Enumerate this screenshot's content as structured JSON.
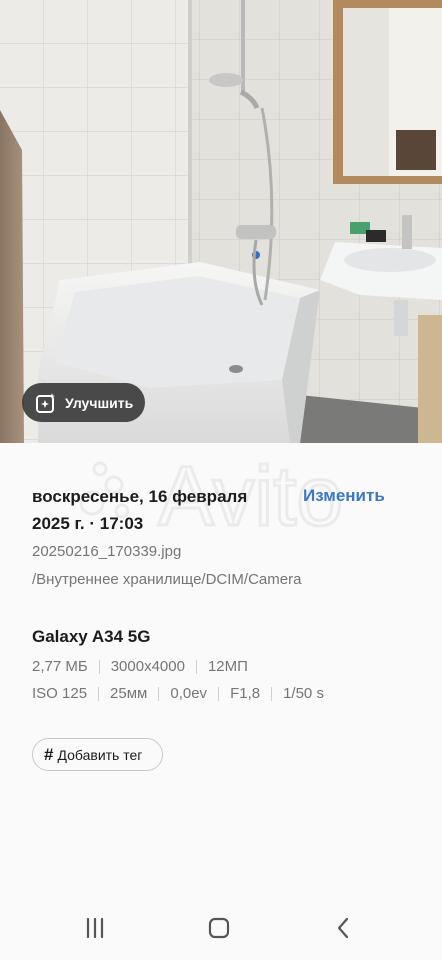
{
  "enhance": {
    "label": "Улучшить",
    "icon": "sparkle-enhance-icon"
  },
  "watermark": {
    "text": "Avito"
  },
  "info": {
    "date_line1": "воскресенье, 16 февраля",
    "date_line2": "2025 г. · 17:03",
    "edit_label": "Изменить",
    "filename": "20250216_170339.jpg",
    "path": "/Внутреннее хранилище/DCIM/Camera"
  },
  "device": {
    "name": "Galaxy A34 5G",
    "file_size": "2,77 МБ",
    "resolution": "3000x4000",
    "megapixels": "12МП",
    "iso": "ISO 125",
    "focal_length": "25мм",
    "exposure_value": "0,0ev",
    "aperture": "F1,8",
    "shutter": "1/50 s"
  },
  "tag": {
    "label": "Добавить тег",
    "icon": "hash-icon"
  },
  "nav": {
    "recent": "recent-apps-icon",
    "home": "home-icon",
    "back": "back-icon"
  },
  "colors": {
    "accent": "#3c78c6",
    "secondary_text": "#767676",
    "background": "#fafafa"
  }
}
